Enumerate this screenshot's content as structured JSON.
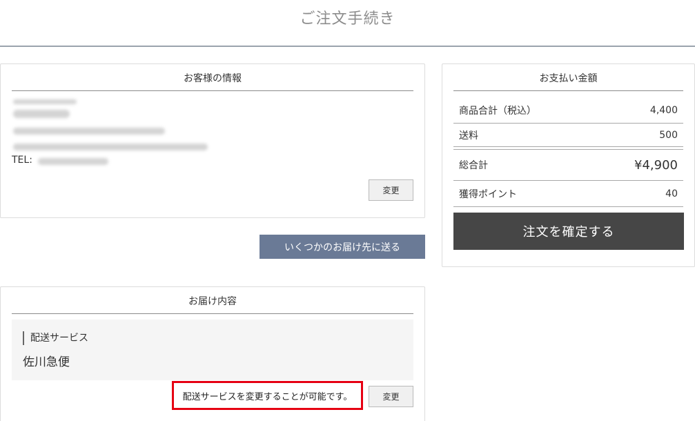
{
  "page": {
    "title": "ご注文手続き"
  },
  "customer": {
    "title": "お客様の情報",
    "tel_label": "TEL:",
    "change_label": "変更"
  },
  "multi_delivery": {
    "label": "いくつかのお届け先に送る"
  },
  "delivery": {
    "title": "お届け内容",
    "service_label": "配送サービス",
    "service_value": "佐川急便",
    "note": "配送サービスを変更することが可能です。",
    "change_label": "変更"
  },
  "payment": {
    "title": "お支払い金額",
    "rows": [
      {
        "label": "商品合計（税込）",
        "value": "4,400"
      },
      {
        "label": "送料",
        "value": "500"
      },
      {
        "label": "総合計",
        "value": "¥4,900"
      },
      {
        "label": "獲得ポイント",
        "value": "40"
      }
    ],
    "confirm_label": "注文を確定する"
  },
  "colors": {
    "accent_button": "#6a7a96",
    "confirm_button": "#464646",
    "highlight_border": "#e60012"
  }
}
